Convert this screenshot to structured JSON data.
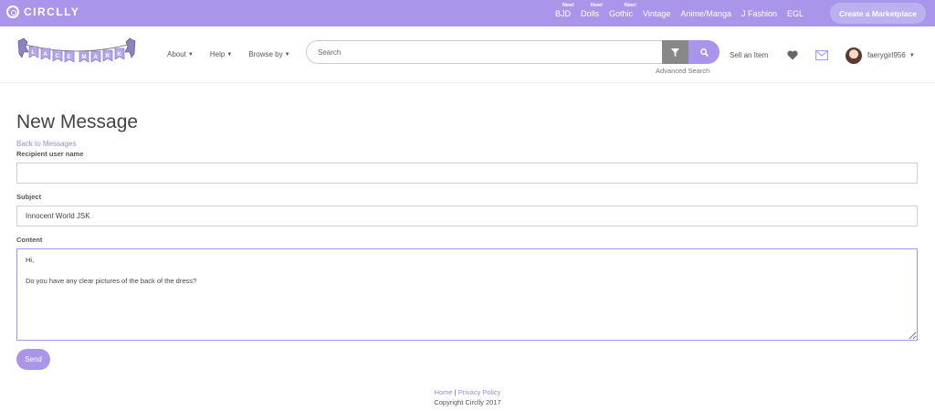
{
  "brand": {
    "name": "CIRCLLY"
  },
  "topnav": {
    "items": [
      {
        "label": "BJD",
        "badge": "New!"
      },
      {
        "label": "Dolls",
        "badge": "New!"
      },
      {
        "label": "Gothic",
        "badge": "New!"
      },
      {
        "label": "Vintage",
        "badge": ""
      },
      {
        "label": "Anime/Manga",
        "badge": ""
      },
      {
        "label": "J Fashion",
        "badge": ""
      },
      {
        "label": "EGL",
        "badge": ""
      }
    ],
    "create_label": "Create a Marketplace"
  },
  "logo": {
    "text": "LACE MARKET"
  },
  "mainnav": {
    "about": "About",
    "help": "Help",
    "browse": "Browse by"
  },
  "search": {
    "placeholder": "Search",
    "advanced": "Advanced Search"
  },
  "header": {
    "sell": "Sell an Item",
    "username": "faerygirl956"
  },
  "form": {
    "title": "New Message",
    "back": "Back to Messages",
    "recipient_label": "Recipient user name",
    "recipient_value": "",
    "subject_label": "Subject",
    "subject_value": "Innocent World JSK",
    "content_label": "Content",
    "content_value": "Hi,\n\nDo you have any clear pictures of the back of the dress?",
    "send": "Send"
  },
  "footer": {
    "home": "Home",
    "separator": "|",
    "privacy": "Privacy Policy",
    "copyright": "Copyright Circlly 2017"
  },
  "colors": {
    "accent": "#a996ea",
    "accent_light": "#bdb0f1",
    "filter_gray": "#888888"
  }
}
